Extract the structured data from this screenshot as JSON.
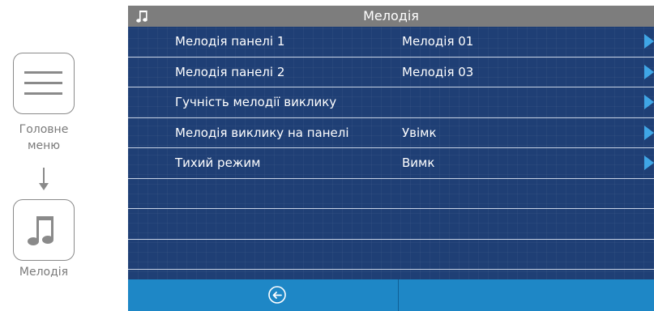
{
  "guide": {
    "main_menu_label_line1": "Головне",
    "main_menu_label_line2": "меню",
    "melody_label": "Мелодія",
    "main_menu_icon": "menu-lines-icon",
    "melody_icon": "music-note-icon"
  },
  "screen": {
    "title": "Мелодія",
    "title_icon": "music-note-icon",
    "items": [
      {
        "label": "Мелодія панелі 1",
        "value": "Мелодія 01"
      },
      {
        "label": "Мелодія панелі 2",
        "value": "Мелодія 03"
      },
      {
        "label": "Гучність мелодії виклику",
        "value": ""
      },
      {
        "label": "Мелодія виклику на панелі",
        "value": "Увімк"
      },
      {
        "label": "Тихий режим",
        "value": "Вимк"
      }
    ],
    "empty_rows": 3,
    "back_icon": "back-arrow-icon"
  },
  "colors": {
    "screen_bg": "#1f3f75",
    "titlebar_bg": "#7d7d7d",
    "bottombar_bg": "#1e87c6",
    "chevron": "#3fa6e6"
  }
}
